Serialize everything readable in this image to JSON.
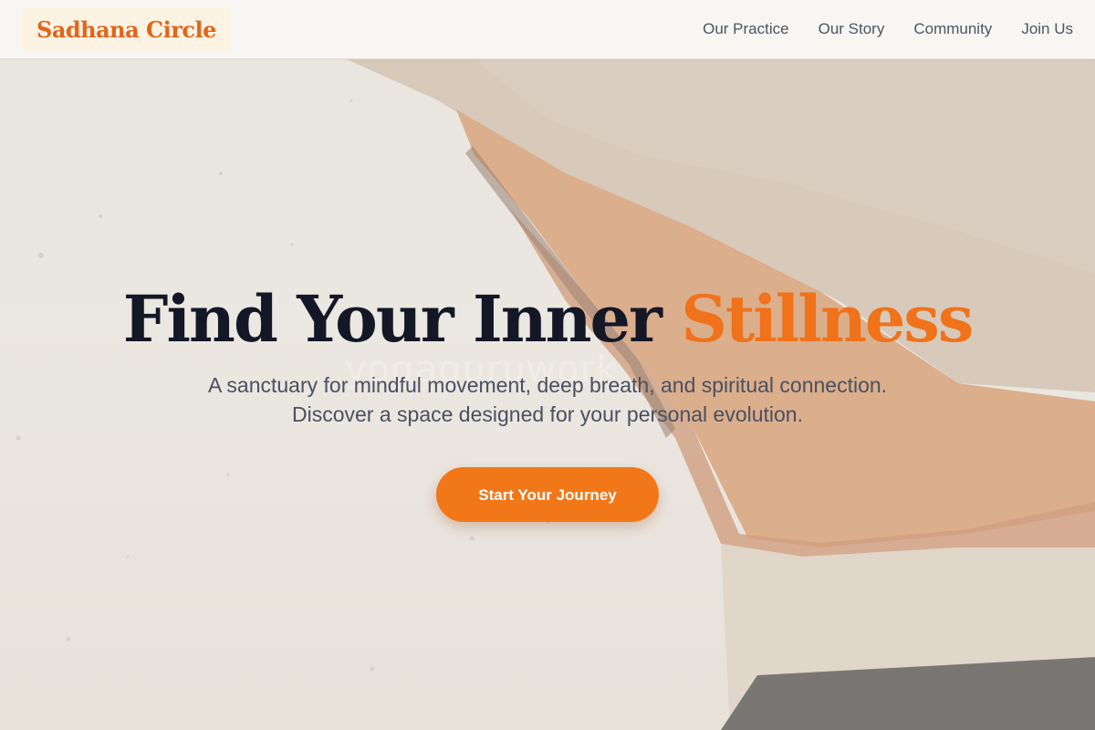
{
  "brand": {
    "name": "Sadhana Circle"
  },
  "nav": {
    "items": [
      {
        "label": "Our Practice"
      },
      {
        "label": "Our Story"
      },
      {
        "label": "Community"
      },
      {
        "label": "Join Us"
      }
    ]
  },
  "hero": {
    "title_main": "Find Your Inner ",
    "title_accent": "Stillness",
    "subtitle_line1": "A sanctuary for mindful movement, deep breath, and spiritual connection.",
    "subtitle_line2": "Discover a space designed for your personal evolution.",
    "cta_label": "Start Your Journey",
    "background_watermark": "yogaguruwork"
  },
  "colors": {
    "brand": "#e2651b",
    "accent": "#f0721a",
    "cta": "#f27718",
    "heading": "#141726",
    "body_text": "#4a5060",
    "nav_text": "#4b5563"
  }
}
